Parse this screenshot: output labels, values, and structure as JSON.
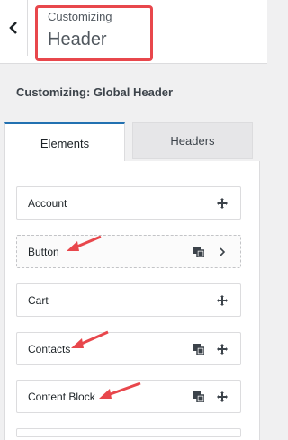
{
  "header": {
    "back_label": "Back",
    "crumb_small": "Customizing",
    "crumb_big": "Header"
  },
  "section_title": "Customizing: Global Header",
  "tabs": [
    {
      "label": "Elements",
      "active": true
    },
    {
      "label": "Headers",
      "active": false
    }
  ],
  "elements": [
    {
      "label": "Account",
      "icons": [
        "move-icon"
      ]
    },
    {
      "label": "Button",
      "icons": [
        "duplicate-icon",
        "chevron-right-icon"
      ]
    },
    {
      "label": "Cart",
      "icons": [
        "move-icon"
      ]
    },
    {
      "label": "Contacts",
      "icons": [
        "duplicate-icon",
        "move-icon"
      ]
    },
    {
      "label": "Content Block",
      "icons": [
        "duplicate-icon",
        "move-icon"
      ]
    }
  ],
  "colors": {
    "highlight": "#e8474c",
    "accent": "#2271b1"
  }
}
